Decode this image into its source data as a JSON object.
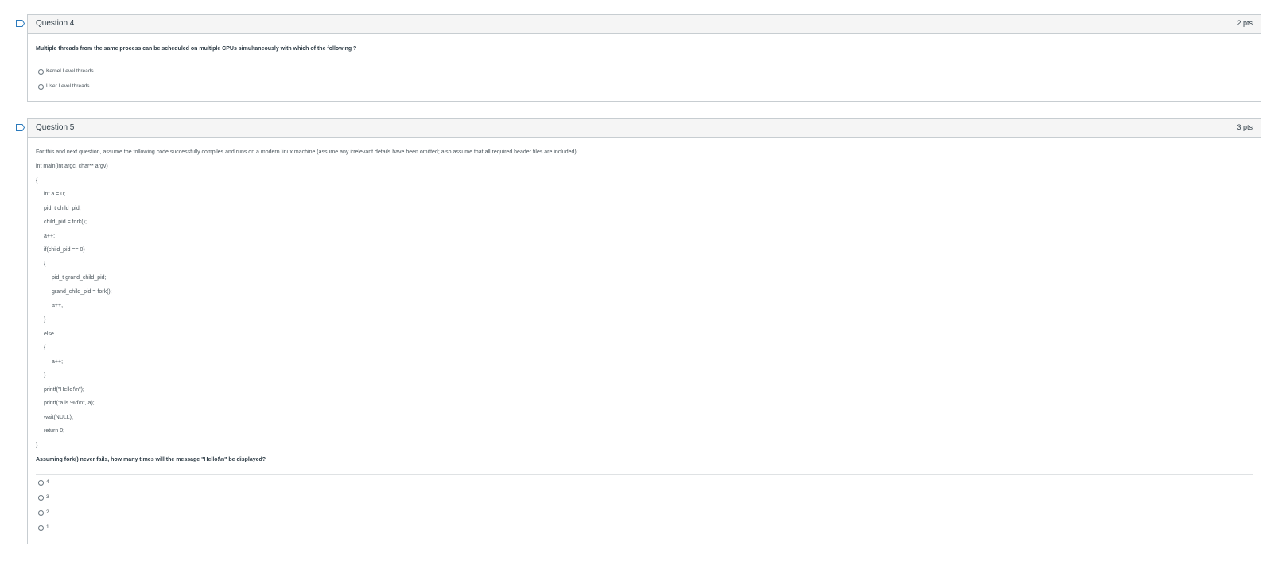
{
  "questions": [
    {
      "title": "Question 4",
      "points": "2 pts",
      "text": "Multiple threads from the same process can be scheduled on multiple CPUs simultaneously with which of the following ?",
      "answers": [
        "Kernel Level threads",
        "User Level threads"
      ]
    },
    {
      "title": "Question 5",
      "points": "3 pts",
      "intro": "For this and next question, assume the following code successfully compiles and runs on a modern linux machine (assume any irrelevant details have been omitted; also assume that all required header files are included):",
      "code": [
        "int main(int argc, char** argv)",
        "{",
        "int a = 0;",
        "pid_t child_pid;",
        "child_pid = fork();",
        "a++;",
        "if(child_pid == 0)",
        "{",
        "pid_t grand_child_pid;",
        "grand_child_pid = fork();",
        "a++;",
        "}",
        "else",
        "{",
        "a++;",
        "}",
        "printf(\"Hello!\\n\");",
        "printf(\"a is %d\\n\", a);",
        "wait(NULL);",
        "return 0;",
        "}"
      ],
      "text": "Assuming fork() never fails, how many times will the message \"Hello!\\n\" be displayed?",
      "answers": [
        "4",
        "3",
        "2",
        "1"
      ]
    }
  ]
}
